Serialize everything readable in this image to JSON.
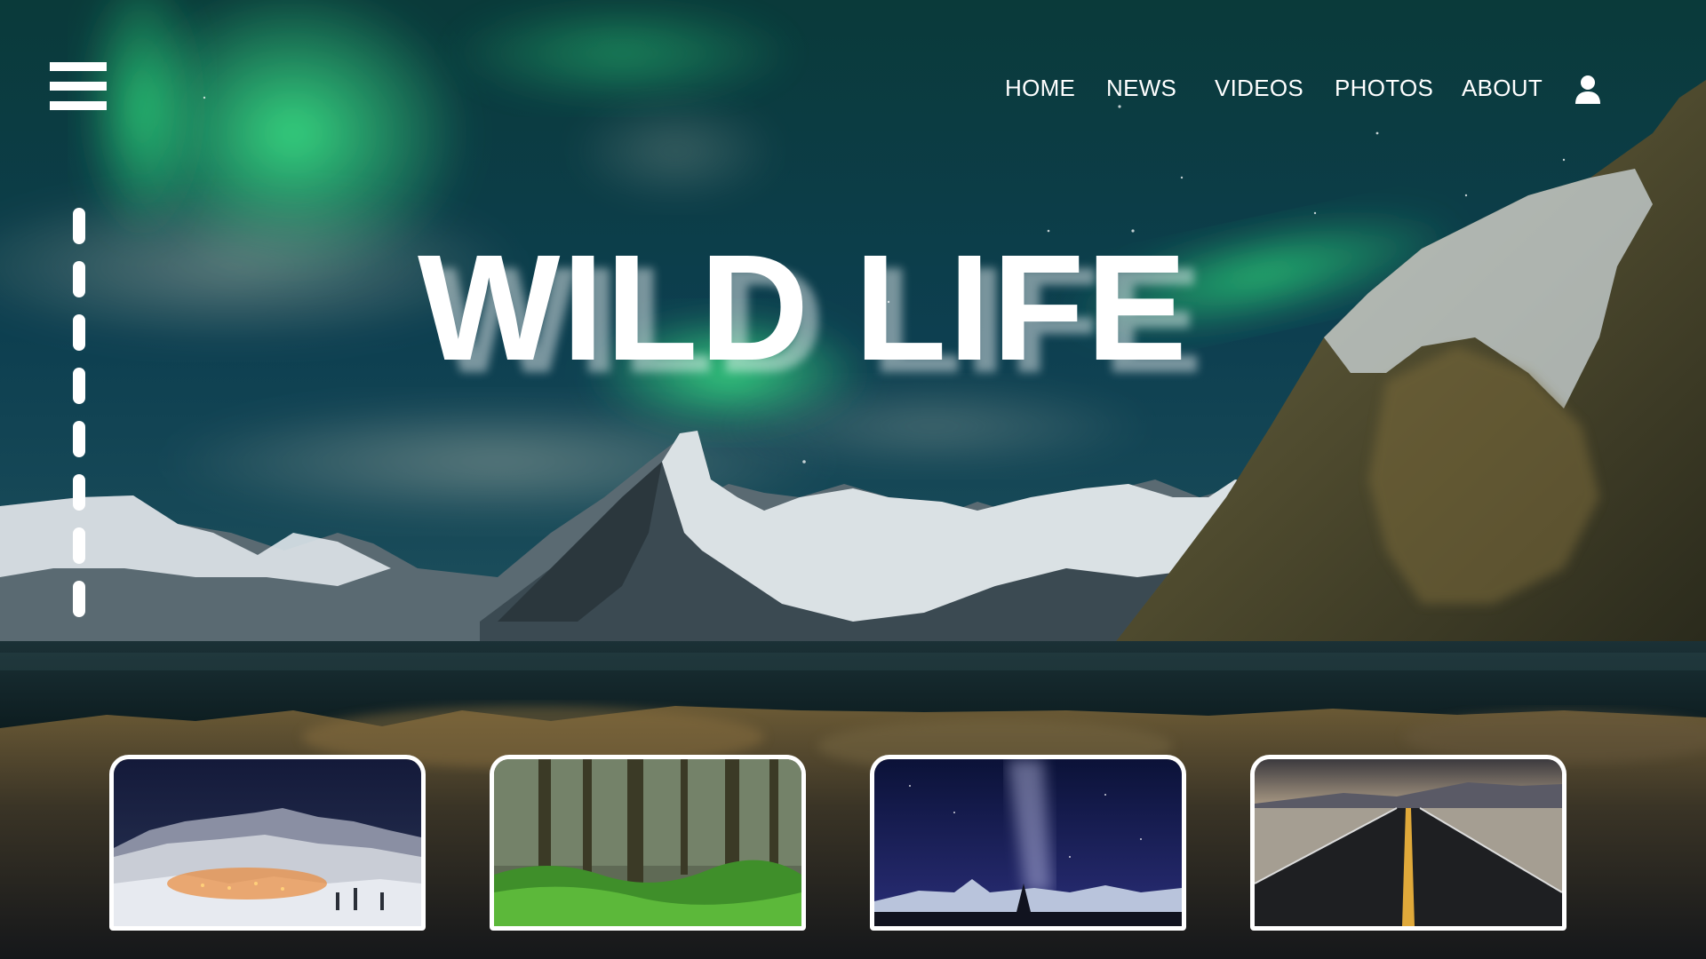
{
  "nav": {
    "items": [
      {
        "label": "HOME"
      },
      {
        "label": "NEWS"
      },
      {
        "label": "VIDEOS"
      },
      {
        "label": "PHOTOS"
      },
      {
        "label": "ABOUT"
      }
    ],
    "icons": {
      "menu": "hamburger-menu-icon",
      "account": "user-icon"
    }
  },
  "hero": {
    "title": "WILD LIFE"
  },
  "slider": {
    "dash_count": 8
  },
  "thumbnails": [
    {
      "subject": "snowy mountain village at night"
    },
    {
      "subject": "mossy green forest"
    },
    {
      "subject": "milky way over mountains"
    },
    {
      "subject": "desert road at dusk"
    }
  ],
  "colors": {
    "text": "#ffffff",
    "aurora": "#2fd27a",
    "sky": "#0b2f4f"
  }
}
